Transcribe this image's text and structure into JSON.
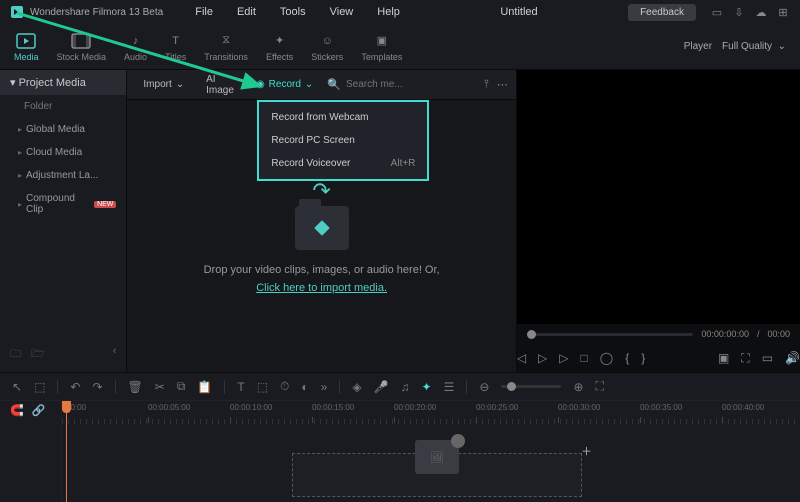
{
  "app": {
    "name": "Wondershare Filmora 13 Beta"
  },
  "menubar": [
    "File",
    "Edit",
    "Tools",
    "View",
    "Help"
  ],
  "document_title": "Untitled",
  "feedback_label": "Feedback",
  "tools": [
    {
      "id": "media",
      "label": "Media",
      "active": true
    },
    {
      "id": "stock",
      "label": "Stock Media"
    },
    {
      "id": "audio",
      "label": "Audio"
    },
    {
      "id": "titles",
      "label": "Titles"
    },
    {
      "id": "transitions",
      "label": "Transitions"
    },
    {
      "id": "effects",
      "label": "Effects"
    },
    {
      "id": "stickers",
      "label": "Stickers"
    },
    {
      "id": "templates",
      "label": "Templates"
    }
  ],
  "player": {
    "label": "Player",
    "quality": "Full Quality",
    "time_current": "00:00:00:00",
    "time_total": "00:00"
  },
  "sidebar": {
    "header": "Project Media",
    "folder_label": "Folder",
    "items": [
      {
        "label": "Global Media"
      },
      {
        "label": "Cloud Media"
      },
      {
        "label": "Adjustment La..."
      },
      {
        "label": "Compound Clip",
        "badge": "NEW"
      }
    ]
  },
  "center_toolbar": {
    "import": "Import",
    "ai_image": "AI Image",
    "record": "Record",
    "search_placeholder": "Search me..."
  },
  "record_menu": [
    {
      "label": "Record from Webcam",
      "shortcut": ""
    },
    {
      "label": "Record PC Screen",
      "shortcut": ""
    },
    {
      "label": "Record Voiceover",
      "shortcut": "Alt+R"
    }
  ],
  "dropzone": {
    "line1": "Drop your video clips, images, or audio here! Or,",
    "link": "Click here to import media."
  },
  "timeline_ticks": [
    "00:00",
    "00:00:05:00",
    "00:00:10:00",
    "00:00:15:00",
    "00:00:20:00",
    "00:00:25:00",
    "00:00:30:00",
    "00:00:35:00",
    "00:00:40:00"
  ]
}
